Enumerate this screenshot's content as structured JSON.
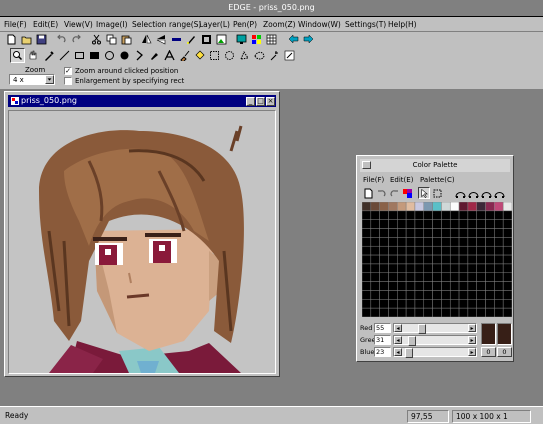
{
  "app": {
    "title": "EDGE - priss_050.png"
  },
  "menu": {
    "items": [
      "File(F)",
      "Edit(E)",
      "View(V)",
      "Image(I)",
      "Selection range(S)",
      "Layer(L)",
      "Pen(P)",
      "Zoom(Z)",
      "Window(W)",
      "Settings(T)",
      "Help(H)"
    ]
  },
  "toolbar1": {
    "icons": [
      "new-file-icon",
      "open-folder-icon",
      "save-disk-icon",
      "undo-icon",
      "redo-icon",
      "cut-scissors-icon",
      "copy-icon",
      "paste-icon",
      "flip-horizontal-icon",
      "flip-vertical-icon",
      "color-replace-icon",
      "pen-tool-icon",
      "frame-icon",
      "image-view-icon",
      "monitor-icon",
      "palette-grid-icon",
      "grid-icon",
      "arrow-left-icon",
      "arrow-right-icon"
    ]
  },
  "toolbar2": {
    "icons": [
      "magnifier-icon",
      "hand-icon",
      "dropper-icon",
      "line-icon",
      "filled-rect-icon",
      "filled-circle-icon",
      "circle-icon",
      "pen-icon",
      "text-icon",
      "spray-icon",
      "fill-bucket-icon",
      "select-rect-icon",
      "select-ellipse-icon",
      "select-lasso-icon",
      "select-free-icon",
      "magic-select-icon",
      "select-color-icon"
    ]
  },
  "zoom": {
    "label": "Zoom",
    "value": "4 x",
    "option_clicked": "Zoom around clicked position",
    "option_clicked_checked": true,
    "option_rect": "Enlargement by specifying rect",
    "option_rect_checked": false
  },
  "image_window": {
    "title": "priss_050.png"
  },
  "palette_window": {
    "title": "Color Palette",
    "menu": [
      "File(F)",
      "Edit(E)",
      "Palette(C)"
    ],
    "swatches": [
      "#403028",
      "#6a4a38",
      "#8a6248",
      "#a07860",
      "#c49a7c",
      "#e0bca0",
      "#c8c8e0",
      "#7c98b0",
      "#5ac0c8",
      "#d0d8d8",
      "#fcfcfc",
      "#601830",
      "#a02848",
      "#3c2838",
      "#882850",
      "#c04878",
      "#e8e8e8"
    ],
    "red_label": "Red",
    "red_value": 55,
    "green_label": "Gree",
    "green_value": 31,
    "blue_label": "Blue",
    "blue_value": 23,
    "current_color": "#371f17",
    "index_a": "0",
    "index_b": "0"
  },
  "status": {
    "text": "Ready",
    "coords": "97,55",
    "size": "100 x 100 x 1"
  }
}
